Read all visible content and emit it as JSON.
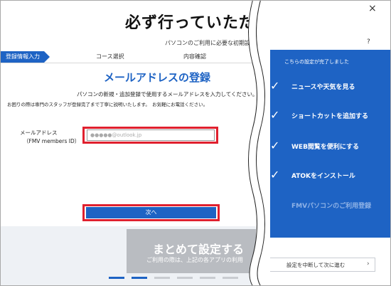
{
  "left_app": {
    "main_heading": "必ず行っていただ",
    "sub_heading": "パソコンのご利用に必要な初期設",
    "steps": {
      "active": "登録情報入力",
      "course": "コース選択",
      "confirm": "内容確認"
    },
    "panel_title": "メールアドレスの登録",
    "desc_line1": "パソコンの新規・追加登録で使用するメールアドレスを入力してください。",
    "desc_line2": "お困りの際は専門のスタッフが登録完了まで丁寧に説明いたします。　お気軽にお電話ください。",
    "email_label": "メールアドレス",
    "email_label_sub": "（FMV members ID）",
    "email_value": "●●●●●@outlook.jp",
    "next_label": "次へ",
    "setup_card_title": "まとめて設定する",
    "setup_card_sub": "ご利用の際は、上記の各アプリの利用"
  },
  "right_app": {
    "close_glyph": "×",
    "help_glyph": "?",
    "complete_text": "こちらの設定が完了しました",
    "tasks": [
      {
        "label": "ニュースや天気を見る"
      },
      {
        "label": "ショートカットを追加する"
      },
      {
        "label": "WEB閲覧を便利にする"
      },
      {
        "label": "ATOKをインストール"
      }
    ],
    "pending_task": "FMVパソコンのご利用登録",
    "skip_label": "設定を中断して次に進む",
    "skip_arrow": "›"
  },
  "check_glyph": "✓",
  "colors": {
    "accent": "#1e63c4",
    "highlight": "#e0202e"
  }
}
